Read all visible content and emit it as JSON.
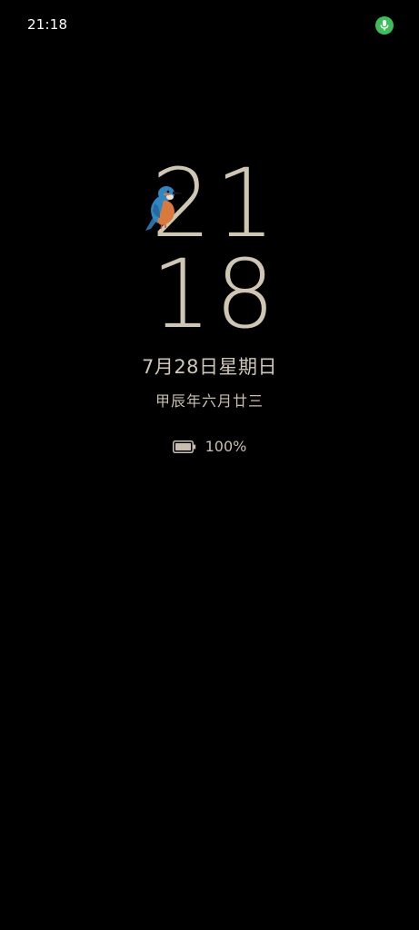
{
  "status_bar": {
    "time": "21:18",
    "mic_indicator_color": "#3cbf5a",
    "mic_icon": "microphone-icon"
  },
  "clock": {
    "hours": "21",
    "minutes": "18",
    "decoration_icon": "kingfisher-bird-icon"
  },
  "date": {
    "gregorian": "7月28日星期日",
    "lunar": "甲辰年六月廿三"
  },
  "battery": {
    "icon": "battery-icon",
    "level_percent": 100,
    "label": "100%"
  },
  "colors": {
    "background": "#000000",
    "clock_text": "#cfc6b4",
    "status_text": "#ffffff"
  }
}
